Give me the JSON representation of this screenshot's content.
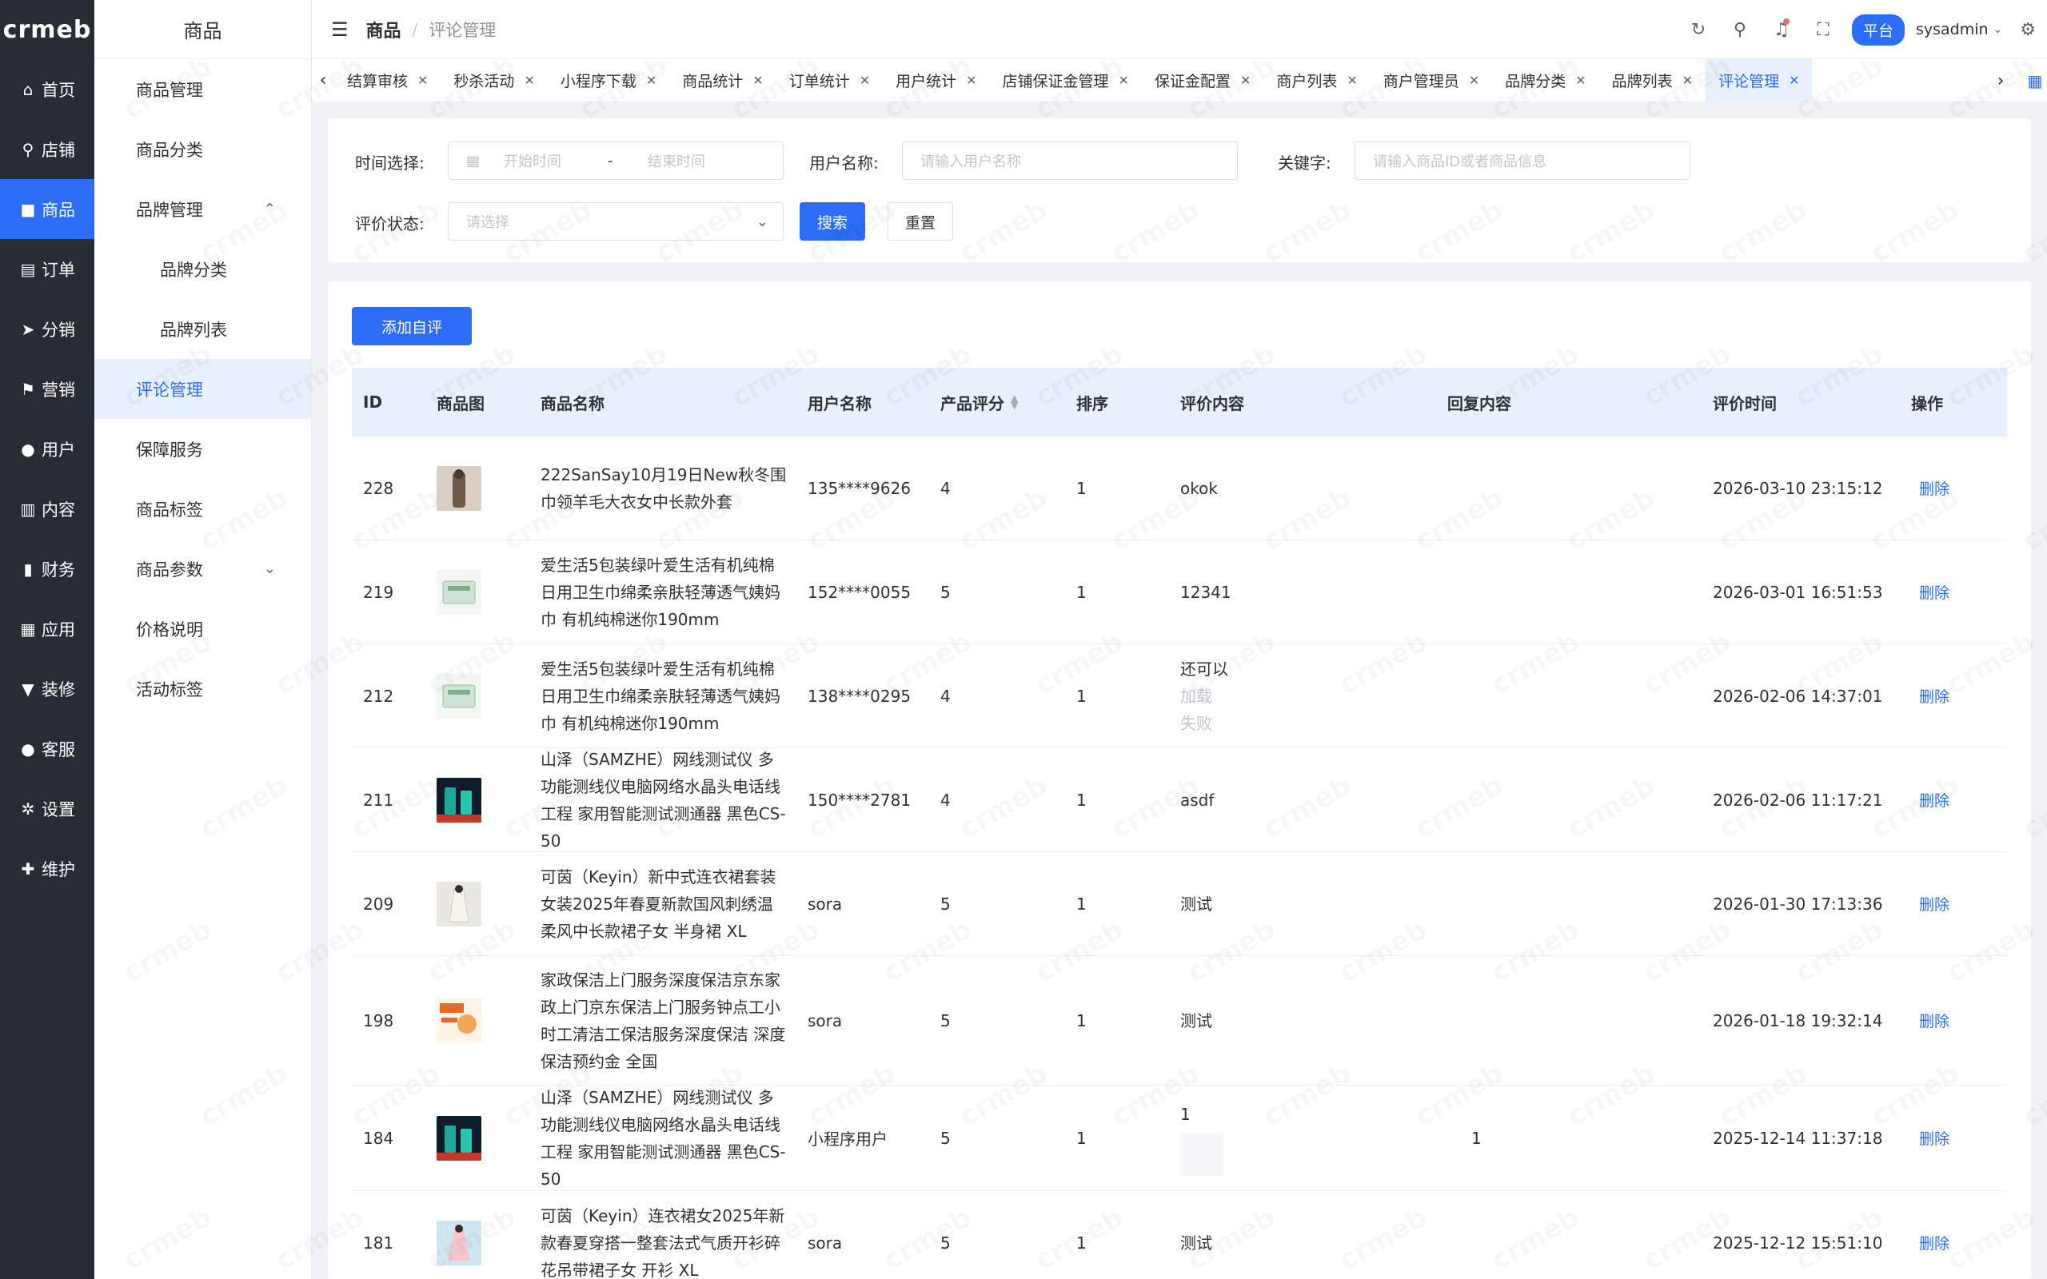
{
  "logo": "crmeb",
  "rail": [
    {
      "icon": "⌂",
      "label": "首页"
    },
    {
      "icon": "⚲",
      "label": "店铺"
    },
    {
      "icon": "■",
      "label": "商品",
      "active": true
    },
    {
      "icon": "▤",
      "label": "订单"
    },
    {
      "icon": "➤",
      "label": "分销"
    },
    {
      "icon": "⚑",
      "label": "营销"
    },
    {
      "icon": "●",
      "label": "用户"
    },
    {
      "icon": "▥",
      "label": "内容"
    },
    {
      "icon": "▮",
      "label": "财务"
    },
    {
      "icon": "▦",
      "label": "应用"
    },
    {
      "icon": "▼",
      "label": "装修"
    },
    {
      "icon": "●",
      "label": "客服"
    },
    {
      "icon": "✲",
      "label": "设置"
    },
    {
      "icon": "✚",
      "label": "维护"
    }
  ],
  "submenu": {
    "title": "商品",
    "items": [
      {
        "label": "商品管理"
      },
      {
        "label": "商品分类"
      },
      {
        "label": "品牌管理",
        "chev": "⌃"
      },
      {
        "label": "品牌分类",
        "child": true
      },
      {
        "label": "品牌列表",
        "child": true
      },
      {
        "label": "评论管理",
        "active": true
      },
      {
        "label": "保障服务"
      },
      {
        "label": "商品标签"
      },
      {
        "label": "商品参数",
        "chev": "⌄"
      },
      {
        "label": "价格说明"
      },
      {
        "label": "活动标签"
      }
    ]
  },
  "header": {
    "breadcrumb_parent": "商品",
    "breadcrumb_sep": "/",
    "breadcrumb_current": "评论管理",
    "platform": "平台",
    "username": "sysadmin"
  },
  "tabs": [
    {
      "label": "结算审核"
    },
    {
      "label": "秒杀活动"
    },
    {
      "label": "小程序下载"
    },
    {
      "label": "商品统计"
    },
    {
      "label": "订单统计"
    },
    {
      "label": "用户统计"
    },
    {
      "label": "店铺保证金管理"
    },
    {
      "label": "保证金配置"
    },
    {
      "label": "商户列表"
    },
    {
      "label": "商户管理员"
    },
    {
      "label": "品牌分类"
    },
    {
      "label": "品牌列表"
    },
    {
      "label": "评论管理",
      "active": true
    }
  ],
  "filter": {
    "time_label": "时间选择:",
    "start_placeholder": "开始时间",
    "range_sep": "-",
    "end_placeholder": "结束时间",
    "user_label": "用户名称:",
    "user_placeholder": "请输入用户名称",
    "keyword_label": "关键字:",
    "keyword_placeholder": "请输入商品ID或者商品信息",
    "status_label": "评价状态:",
    "status_placeholder": "请选择",
    "search_btn": "搜索",
    "reset_btn": "重置"
  },
  "add_button": "添加自评",
  "table": {
    "headers": {
      "id": "ID",
      "image": "商品图",
      "name": "商品名称",
      "user": "用户名称",
      "score": "产品评分",
      "sort": "排序",
      "content": "评价内容",
      "reply": "回复内容",
      "time": "评价时间",
      "action": "操作"
    },
    "rows": [
      {
        "id": "228",
        "name": "222SanSay10月19日New秋冬围巾领羊毛大衣女中长款外套",
        "user": "135****9626",
        "score": "4",
        "sort": "1",
        "content": "okok",
        "content_extra": [],
        "reply": "",
        "time": "2026-03-10 23:15:12",
        "action": "删除",
        "thumb": "coat"
      },
      {
        "id": "219",
        "name": "爱生活5包装绿叶爱生活有机纯棉日用卫生巾绵柔亲肤轻薄透气姨妈巾 有机纯棉迷你190mm",
        "user": "152****0055",
        "score": "5",
        "sort": "1",
        "content": "12341",
        "content_extra": [],
        "reply": "",
        "time": "2026-03-01 16:51:53",
        "action": "删除",
        "thumb": "pad"
      },
      {
        "id": "212",
        "name": "爱生活5包装绿叶爱生活有机纯棉日用卫生巾绵柔亲肤轻薄透气姨妈巾 有机纯棉迷你190mm",
        "user": "138****0295",
        "score": "4",
        "sort": "1",
        "content": "还可以",
        "content_extra": [
          "加载",
          "失败"
        ],
        "reply": "",
        "time": "2026-02-06 14:37:01",
        "action": "删除",
        "thumb": "pad"
      },
      {
        "id": "211",
        "name": "山泽（SAMZHE）网线测试仪 多功能测线仪电脑网络水晶头电话线工程 家用智能测试测通器 黑色CS-50",
        "user": "150****2781",
        "score": "4",
        "sort": "1",
        "content": "asdf",
        "content_extra": [],
        "reply": "",
        "time": "2026-02-06 11:17:21",
        "action": "删除",
        "thumb": "tester"
      },
      {
        "id": "209",
        "name": "可茵（Keyin）新中式连衣裙套装女装2025年春夏新款国风刺绣温柔风中长款裙子女 半身裙 XL",
        "user": "sora",
        "score": "5",
        "sort": "1",
        "content": "测试",
        "content_extra": [],
        "reply": "",
        "time": "2026-01-30 17:13:36",
        "action": "删除",
        "thumb": "dress"
      },
      {
        "id": "198",
        "name": "家政保洁上门服务深度保洁京东家政上门京东保洁上门服务钟点工小时工清洁工保洁服务深度保洁 深度保洁预约金 全国",
        "user": "sora",
        "score": "5",
        "sort": "1",
        "content": "测试",
        "content_extra": [],
        "reply": "",
        "time": "2026-01-18 19:32:14",
        "action": "删除",
        "thumb": "clean"
      },
      {
        "id": "184",
        "name": "山泽（SAMZHE）网线测试仪 多功能测线仪电脑网络水晶头电话线工程 家用智能测试测通器 黑色CS-50",
        "user": "小程序用户",
        "score": "5",
        "sort": "1",
        "content": "1",
        "content_extra": [],
        "reply": "1",
        "time": "2025-12-14 11:37:18",
        "action": "删除",
        "thumb": "tester",
        "content_image": true
      },
      {
        "id": "181",
        "name": "可茵（Keyin）连衣裙女2025年新款春夏穿搭一整套法式气质开衫碎花吊带裙子女 开衫 XL",
        "user": "sora",
        "score": "5",
        "sort": "1",
        "content": "测试",
        "content_extra": [],
        "reply": "",
        "time": "2025-12-12 15:51:10",
        "action": "删除",
        "thumb": "floral"
      }
    ]
  },
  "colors": {
    "primary": "#2d6cf6",
    "rail_bg": "#282c34",
    "header_row_bg": "#e8f0fe"
  }
}
